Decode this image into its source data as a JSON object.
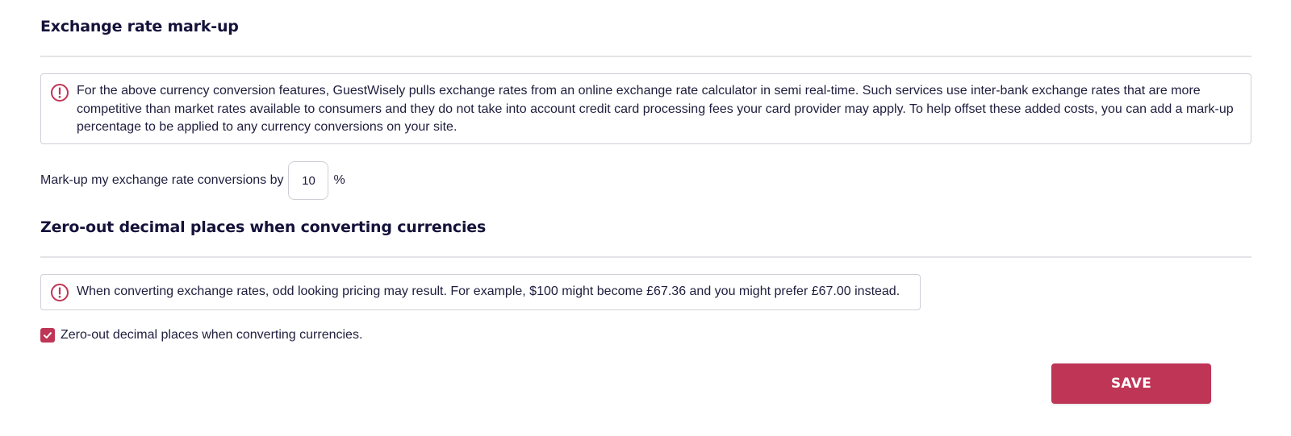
{
  "colors": {
    "accent": "#bf3556",
    "text": "#1f1d3d",
    "heading": "#14123a",
    "border": "#cfcfd8",
    "divider": "#e3e3e8"
  },
  "markup_section": {
    "title": "Exchange rate mark-up",
    "notice_icon": "alert-circle-icon",
    "notice_text": "For the above currency conversion features, GuestWisely pulls exchange rates from an online exchange rate calculator in semi real-time. Such services use inter-bank exchange rates that are more competitive than market rates available to consumers and they do not take into account credit card processing fees your card provider may apply. To help offset these added costs, you can add a mark-up percentage to be applied to any currency conversions on your site.",
    "input_label": "Mark-up my exchange rate conversions by",
    "input_value": "10",
    "input_suffix": "%"
  },
  "decimal_section": {
    "title": "Zero-out decimal places when converting currencies",
    "notice_icon": "alert-circle-icon",
    "notice_text": "When converting exchange rates, odd looking pricing may result. For example, $100 might become £67.36 and you might prefer £67.00 instead.",
    "checkbox_checked": true,
    "checkbox_label": "Zero-out decimal places when converting currencies."
  },
  "actions": {
    "save_label": "SAVE"
  }
}
